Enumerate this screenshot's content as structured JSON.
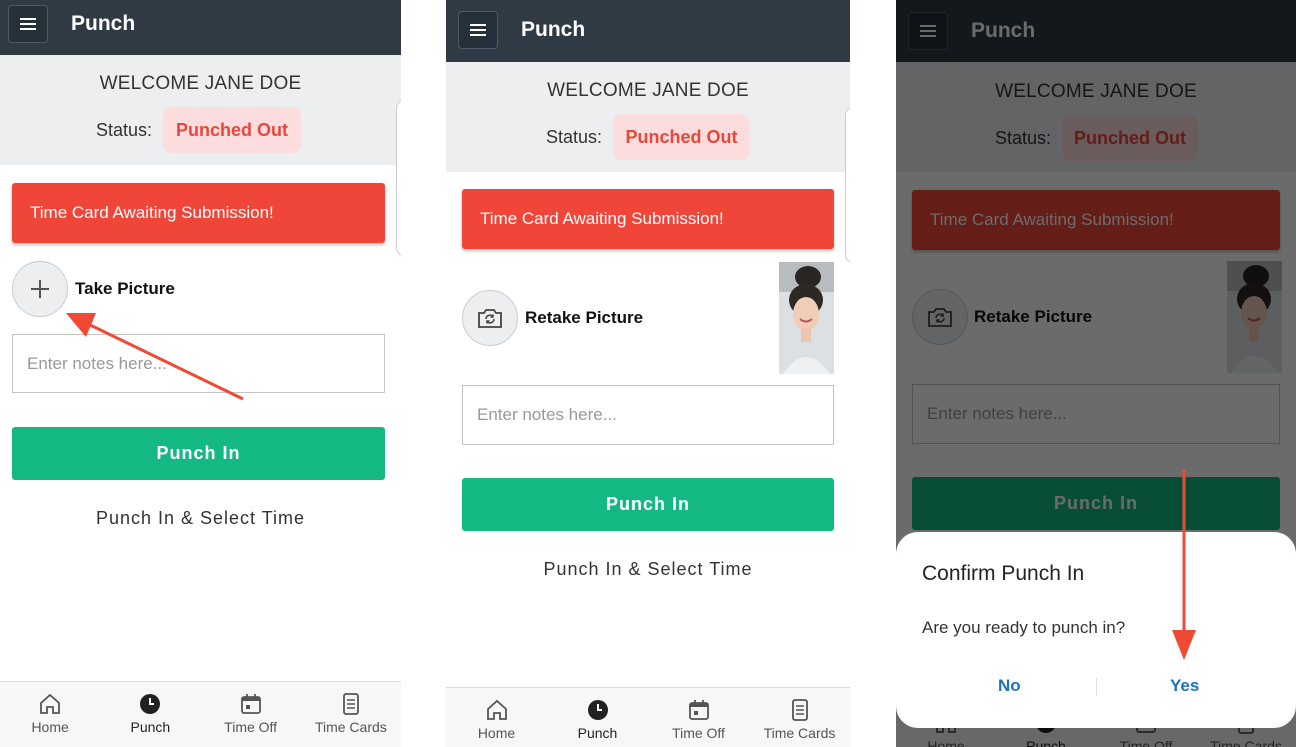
{
  "app": {
    "title": "Punch",
    "welcome": "WELCOME JANE DOE",
    "status_label": "Status:",
    "status_value": "Punched Out",
    "alert": "Time Card Awaiting Submission!",
    "notes_placeholder": "Enter notes here...",
    "punch_in": "Punch In",
    "punch_select_time": "Punch In & Select Time"
  },
  "step1": {
    "picture_label": "Take Picture"
  },
  "step2": {
    "picture_label": "Retake Picture"
  },
  "nav": {
    "items": [
      {
        "label": "Home",
        "icon": "home-icon"
      },
      {
        "label": "Punch",
        "icon": "clock-icon",
        "active": true
      },
      {
        "label": "Time Off",
        "icon": "calendar-icon"
      },
      {
        "label": "Time Cards",
        "icon": "document-icon"
      }
    ]
  },
  "dialog": {
    "title": "Confirm Punch In",
    "message": "Are you ready to punch in?",
    "no": "No",
    "yes": "Yes"
  },
  "colors": {
    "header": "#2f3a45",
    "alert": "#f0463a",
    "punch_button": "#14b882",
    "status_text": "#e8473d",
    "status_bg": "#fcdcdc",
    "dialog_button": "#1a72c8",
    "annotation_arrow": "#f04a35"
  }
}
